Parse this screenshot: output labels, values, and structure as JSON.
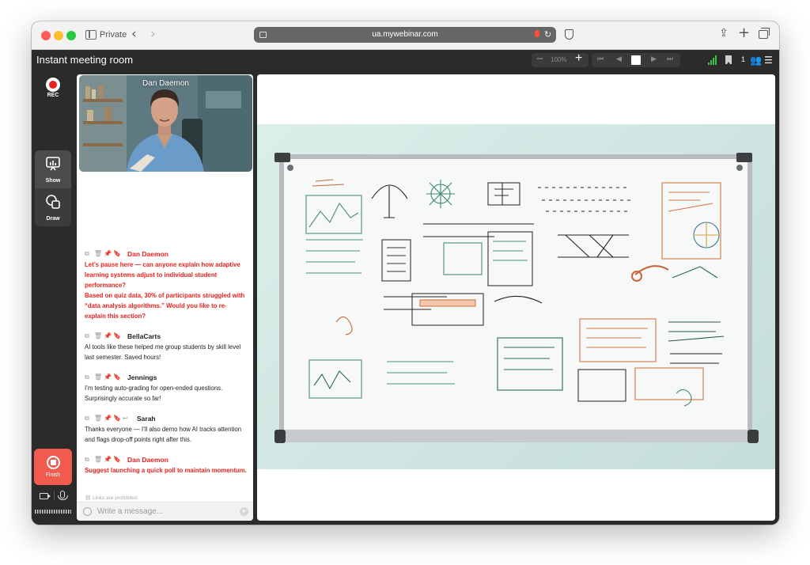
{
  "browser": {
    "private_label": "Private",
    "url": "ua.mywebinar.com"
  },
  "app": {
    "title": "Instant meeting room",
    "zoom": "100%",
    "participants": "1"
  },
  "toolbar": {
    "rec_label": "REC",
    "show_label": "Show",
    "draw_label": "Draw",
    "finish_label": "Finish"
  },
  "video": {
    "presenter_name": "Dan Daemon"
  },
  "chat": {
    "messages": [
      {
        "author": "Dan Daemon",
        "is_host": true,
        "text": "Let’s pause here — can anyone explain how adaptive learning systems adjust to individual student performance?\nBased on quiz data, 30% of participants struggled with “data analysis algorithms.” Would you like to re-explain this section?"
      },
      {
        "author": "BellaCarts",
        "is_host": false,
        "text": "AI tools like these helped me group students by skill level last semester. Saved hours!"
      },
      {
        "author": "Jennings",
        "is_host": false,
        "text": "I’m testing auto-grading for open-ended questions. Surprisingly accurate so far!"
      },
      {
        "author": "Sarah",
        "is_host": false,
        "text": "Thanks everyone — I’ll also demo how AI tracks attention and flags drop-off points right after this."
      },
      {
        "author": "Dan Daemon",
        "is_host": true,
        "text": "Suggest launching a quick poll to maintain momentum."
      }
    ],
    "links_note": "Links are prohibited",
    "input_placeholder": "Write a message..."
  }
}
